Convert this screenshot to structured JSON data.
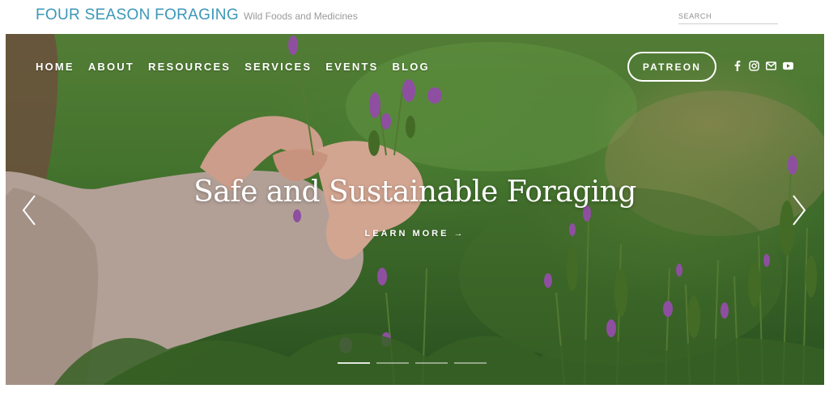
{
  "header": {
    "site_title": "FOUR SEASON FORAGING",
    "tagline": "Wild Foods and Medicines",
    "search_placeholder": "SEARCH"
  },
  "nav": {
    "items": [
      {
        "label": "HOME"
      },
      {
        "label": "ABOUT"
      },
      {
        "label": "RESOURCES"
      },
      {
        "label": "SERVICES"
      },
      {
        "label": "EVENTS"
      },
      {
        "label": "BLOG"
      }
    ],
    "patreon_label": "PATREON",
    "social_icons": [
      "facebook-icon",
      "instagram-icon",
      "email-icon",
      "youtube-icon"
    ]
  },
  "hero": {
    "title": "Safe and Sustainable Foraging",
    "cta_label": "LEARN MORE →",
    "slide_count": 4,
    "active_slide": 1
  },
  "colors": {
    "brand": "#3b97b8",
    "tagline": "#9a9a9a",
    "hero_text": "#ffffff",
    "lavender": "#9b4fb0"
  }
}
